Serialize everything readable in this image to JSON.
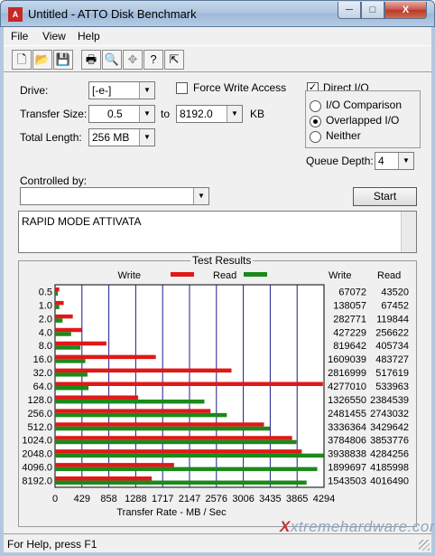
{
  "window": {
    "title": "Untitled - ATTO Disk Benchmark",
    "minimize": "─",
    "maximize": "□",
    "close": "X"
  },
  "menu": [
    "File",
    "View",
    "Help"
  ],
  "toolbar": {
    "icons": [
      "new-icon",
      "open-icon",
      "save-icon",
      "print-icon",
      "print-preview-icon",
      "move-icon",
      "help-icon",
      "context-help-icon"
    ]
  },
  "settings": {
    "drive_label": "Drive:",
    "drive_value": "[-e-]",
    "transfer_label": "Transfer Size:",
    "transfer_from": "0.5",
    "transfer_to_label": "to",
    "transfer_to": "8192.0",
    "transfer_unit": "KB",
    "length_label": "Total Length:",
    "length_value": "256 MB",
    "force_write_label": "Force Write Access",
    "force_write_checked": false,
    "direct_io_label": "Direct I/O",
    "direct_io_checked": true,
    "io_options": [
      "I/O Comparison",
      "Overlapped I/O",
      "Neither"
    ],
    "io_selected": "Overlapped I/O",
    "queue_label": "Queue Depth:",
    "queue_value": "4",
    "controlled_label": "Controlled by:",
    "controlled_value": "",
    "start_label": "Start",
    "notes": "RAPID MODE ATTIVATA"
  },
  "results": {
    "title": "Test Results",
    "legend_write": "Write",
    "legend_read": "Read",
    "col_write": "Write",
    "col_read": "Read",
    "xlabel": "Transfer Rate - MB / Sec"
  },
  "chart_data": {
    "type": "bar",
    "orientation": "horizontal",
    "title": "Test Results",
    "xlabel": "Transfer Rate - MB / Sec",
    "categories": [
      "0.5",
      "1.0",
      "2.0",
      "4.0",
      "8.0",
      "16.0",
      "32.0",
      "64.0",
      "128.0",
      "256.0",
      "512.0",
      "1024.0",
      "2048.0",
      "4096.0",
      "8192.0"
    ],
    "series": [
      {
        "name": "Write",
        "color": "#e01818",
        "values": [
          67072,
          138057,
          282771,
          427229,
          819642,
          1609039,
          2816999,
          4277010,
          1326550,
          2481455,
          3336364,
          3784806,
          3938838,
          1899697,
          1543503
        ]
      },
      {
        "name": "Read",
        "color": "#1a8a1a",
        "values": [
          43520,
          67452,
          119844,
          256622,
          405734,
          483727,
          517619,
          533963,
          2384539,
          2743032,
          3429642,
          3853776,
          4284256,
          4185998,
          4016490
        ]
      }
    ],
    "xticks": [
      "0",
      "429",
      "858",
      "1288",
      "1717",
      "2147",
      "2576",
      "3006",
      "3435",
      "3865",
      "4294"
    ],
    "xlim": [
      0,
      4294
    ],
    "grid": true
  },
  "statusbar": {
    "text": "For Help, press F1"
  },
  "watermark": {
    "x": "X",
    "text": "xtremehardware.com"
  }
}
